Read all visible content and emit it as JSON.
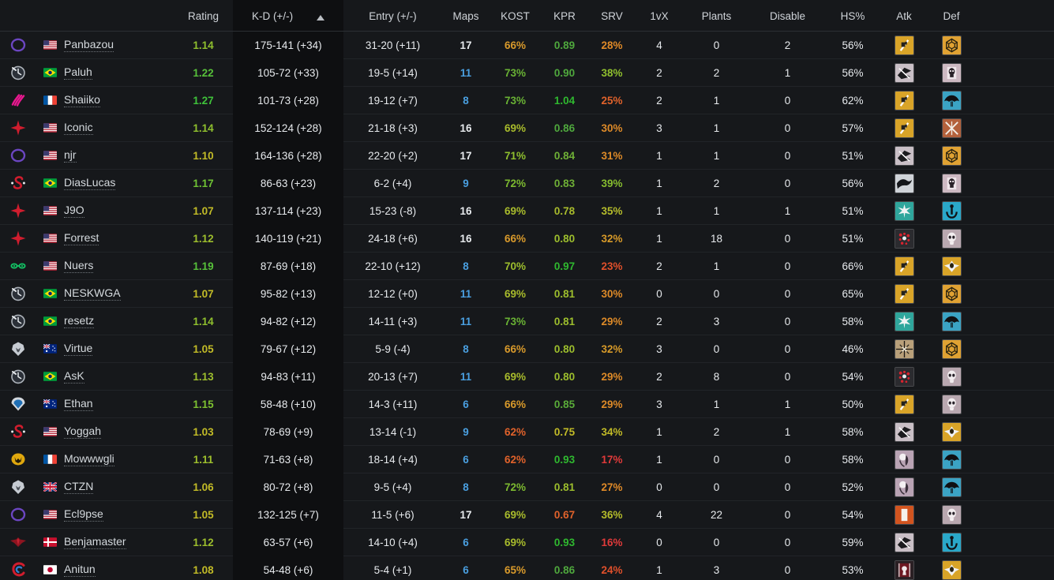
{
  "table": {
    "columns": [
      {
        "key": "logo",
        "label": ""
      },
      {
        "key": "name",
        "label": ""
      },
      {
        "key": "rating",
        "label": "Rating"
      },
      {
        "key": "kd",
        "label": "K-D (+/-)"
      },
      {
        "key": "entry",
        "label": "Entry (+/-)"
      },
      {
        "key": "maps",
        "label": "Maps"
      },
      {
        "key": "kost",
        "label": "KOST"
      },
      {
        "key": "kpr",
        "label": "KPR"
      },
      {
        "key": "srv",
        "label": "SRV"
      },
      {
        "key": "onevx",
        "label": "1vX"
      },
      {
        "key": "plants",
        "label": "Plants"
      },
      {
        "key": "disable",
        "label": "Disable"
      },
      {
        "key": "hs",
        "label": "HS%"
      },
      {
        "key": "atk",
        "label": "Atk"
      },
      {
        "key": "def",
        "label": "Def"
      }
    ],
    "sort": {
      "column": "kd",
      "direction": "ascending",
      "indicator": "sort-ascending-icon"
    },
    "rows": [
      {
        "logo": "purple-ring-logo",
        "flag": "us",
        "name": "Panbazou",
        "rating": "1.14",
        "rating_color": "#8fbf2e",
        "kd": "175-141 (+34)",
        "entry": "31-20 (+11)",
        "maps": "17",
        "maps_color": "#e7eaed",
        "kost": "66%",
        "kost_color": "#d99a2b",
        "kpr": "0.89",
        "kpr_color": "#4fa83d",
        "srv": "28%",
        "srv_color": "#e08a28",
        "onevx": "4",
        "plants": "0",
        "disable": "2",
        "hs": "56%",
        "atk": "op-fist-gold",
        "def": "op-hex-gold"
      },
      {
        "logo": "clock-logo",
        "flag": "br",
        "name": "Paluh",
        "rating": "1.22",
        "rating_color": "#57c03a",
        "kd": "105-72 (+33)",
        "entry": "19-5 (+14)",
        "maps": "11",
        "maps_color": "#4a9fe0",
        "kost": "73%",
        "kost_color": "#69b234",
        "kpr": "0.90",
        "kpr_color": "#4fa83d",
        "srv": "38%",
        "srv_color": "#8fbf2e",
        "onevx": "2",
        "plants": "2",
        "disable": "1",
        "hs": "56%",
        "atk": "op-shard-grey",
        "def": "op-skull-mauve"
      },
      {
        "logo": "pink-waves-logo",
        "flag": "fr",
        "name": "Shaiiko",
        "rating": "1.27",
        "rating_color": "#3fc23a",
        "kd": "101-73 (+28)",
        "entry": "19-12 (+7)",
        "maps": "8",
        "maps_color": "#4a9fe0",
        "kost": "73%",
        "kost_color": "#69b234",
        "kpr": "1.04",
        "kpr_color": "#2fb82f",
        "srv": "25%",
        "srv_color": "#e0622b",
        "onevx": "2",
        "plants": "1",
        "disable": "0",
        "hs": "62%",
        "atk": "op-fist-gold",
        "def": "op-umbrella-teal"
      },
      {
        "logo": "red-star-logo",
        "flag": "us",
        "name": "Iconic",
        "rating": "1.14",
        "rating_color": "#8fbf2e",
        "kd": "152-124 (+28)",
        "entry": "21-18 (+3)",
        "maps": "16",
        "maps_color": "#e7eaed",
        "kost": "69%",
        "kost_color": "#a8bb2c",
        "kpr": "0.86",
        "kpr_color": "#4fa83d",
        "srv": "30%",
        "srv_color": "#dd8a28",
        "onevx": "3",
        "plants": "1",
        "disable": "0",
        "hs": "57%",
        "atk": "op-fist-gold",
        "def": "op-cross-rust"
      },
      {
        "logo": "purple-ring-logo",
        "flag": "us",
        "name": "njr",
        "rating": "1.10",
        "rating_color": "#c2bb27",
        "kd": "164-136 (+28)",
        "entry": "22-20 (+2)",
        "maps": "17",
        "maps_color": "#e7eaed",
        "kost": "71%",
        "kost_color": "#8fbf2e",
        "kpr": "0.84",
        "kpr_color": "#6fb036",
        "srv": "31%",
        "srv_color": "#dd8a28",
        "onevx": "1",
        "plants": "1",
        "disable": "0",
        "hs": "51%",
        "atk": "op-shard-grey",
        "def": "op-hex-gold"
      },
      {
        "logo": "red-s-logo",
        "flag": "br",
        "name": "DiasLucas",
        "rating": "1.17",
        "rating_color": "#6fc234",
        "kd": "86-63 (+23)",
        "entry": "6-2 (+4)",
        "maps": "9",
        "maps_color": "#4a9fe0",
        "kost": "72%",
        "kost_color": "#7dba30",
        "kpr": "0.83",
        "kpr_color": "#6fb036",
        "srv": "39%",
        "srv_color": "#86bd2f",
        "onevx": "1",
        "plants": "2",
        "disable": "0",
        "hs": "56%",
        "atk": "op-bird-dark",
        "def": "op-skull-mauve"
      },
      {
        "logo": "red-star-logo",
        "flag": "us",
        "name": "J9O",
        "rating": "1.07",
        "rating_color": "#c2bb27",
        "kd": "137-114 (+23)",
        "entry": "15-23 (-8)",
        "maps": "16",
        "maps_color": "#e7eaed",
        "kost": "69%",
        "kost_color": "#a8bb2c",
        "kpr": "0.78",
        "kpr_color": "#a8bb2c",
        "srv": "35%",
        "srv_color": "#b5bc2b",
        "onevx": "1",
        "plants": "1",
        "disable": "1",
        "hs": "51%",
        "atk": "op-wings-teal",
        "def": "op-anchor-cyan"
      },
      {
        "logo": "red-star-logo",
        "flag": "us",
        "name": "Forrest",
        "rating": "1.12",
        "rating_color": "#9dbe2d",
        "kd": "140-119 (+21)",
        "entry": "24-18 (+6)",
        "maps": "16",
        "maps_color": "#e7eaed",
        "kost": "66%",
        "kost_color": "#d99a2b",
        "kpr": "0.80",
        "kpr_color": "#9dbe2d",
        "srv": "32%",
        "srv_color": "#d79a29",
        "onevx": "1",
        "plants": "18",
        "disable": "0",
        "hs": "51%",
        "atk": "op-dots-red",
        "def": "op-skull-pale"
      },
      {
        "logo": "green-eyes-logo",
        "flag": "us",
        "name": "Nuers",
        "rating": "1.19",
        "rating_color": "#57c03a",
        "kd": "87-69 (+18)",
        "entry": "22-10 (+12)",
        "maps": "8",
        "maps_color": "#4a9fe0",
        "kost": "70%",
        "kost_color": "#9dbe2d",
        "kpr": "0.97",
        "kpr_color": "#2fb82f",
        "srv": "23%",
        "srv_color": "#e0502b",
        "onevx": "2",
        "plants": "1",
        "disable": "0",
        "hs": "66%",
        "atk": "op-fist-gold",
        "def": "op-wings-gold"
      },
      {
        "logo": "clock-logo",
        "flag": "br",
        "name": "NESKWGA",
        "rating": "1.07",
        "rating_color": "#c2bb27",
        "kd": "95-82 (+13)",
        "entry": "12-12 (+0)",
        "maps": "11",
        "maps_color": "#4a9fe0",
        "kost": "69%",
        "kost_color": "#a8bb2c",
        "kpr": "0.81",
        "kpr_color": "#9dbe2d",
        "srv": "30%",
        "srv_color": "#dd8a28",
        "onevx": "0",
        "plants": "0",
        "disable": "0",
        "hs": "65%",
        "atk": "op-fist-gold",
        "def": "op-hex-gold"
      },
      {
        "logo": "clock-logo",
        "flag": "br",
        "name": "resetz",
        "rating": "1.14",
        "rating_color": "#8fbf2e",
        "kd": "94-82 (+12)",
        "entry": "14-11 (+3)",
        "maps": "11",
        "maps_color": "#4a9fe0",
        "kost": "73%",
        "kost_color": "#69b234",
        "kpr": "0.81",
        "kpr_color": "#9dbe2d",
        "srv": "29%",
        "srv_color": "#dd8a28",
        "onevx": "2",
        "plants": "3",
        "disable": "0",
        "hs": "58%",
        "atk": "op-wings-teal",
        "def": "op-umbrella-teal"
      },
      {
        "logo": "wolf-logo",
        "flag": "au",
        "name": "Virtue",
        "rating": "1.05",
        "rating_color": "#c2bb27",
        "kd": "79-67 (+12)",
        "entry": "5-9 (-4)",
        "maps": "8",
        "maps_color": "#4a9fe0",
        "kost": "66%",
        "kost_color": "#d99a2b",
        "kpr": "0.80",
        "kpr_color": "#9dbe2d",
        "srv": "32%",
        "srv_color": "#d79a29",
        "onevx": "3",
        "plants": "0",
        "disable": "0",
        "hs": "46%",
        "atk": "op-crosshair-tan",
        "def": "op-hex-gold"
      },
      {
        "logo": "clock-logo",
        "flag": "br",
        "name": "AsK",
        "rating": "1.13",
        "rating_color": "#9dbe2d",
        "kd": "94-83 (+11)",
        "entry": "20-13 (+7)",
        "maps": "11",
        "maps_color": "#4a9fe0",
        "kost": "69%",
        "kost_color": "#a8bb2c",
        "kpr": "0.80",
        "kpr_color": "#9dbe2d",
        "srv": "29%",
        "srv_color": "#dd8a28",
        "onevx": "2",
        "plants": "8",
        "disable": "0",
        "hs": "54%",
        "atk": "op-dots-red",
        "def": "op-skull-pale"
      },
      {
        "logo": "blue-helm-logo",
        "flag": "au",
        "name": "Ethan",
        "rating": "1.15",
        "rating_color": "#7dc131",
        "kd": "58-48 (+10)",
        "entry": "14-3 (+11)",
        "maps": "6",
        "maps_color": "#4a9fe0",
        "kost": "66%",
        "kost_color": "#d99a2b",
        "kpr": "0.85",
        "kpr_color": "#5aac39",
        "srv": "29%",
        "srv_color": "#dd8a28",
        "onevx": "3",
        "plants": "1",
        "disable": "1",
        "hs": "50%",
        "atk": "op-fist-gold",
        "def": "op-skull-pale"
      },
      {
        "logo": "red-s-logo",
        "flag": "us",
        "name": "Yoggah",
        "rating": "1.03",
        "rating_color": "#c2bb27",
        "kd": "78-69 (+9)",
        "entry": "13-14 (-1)",
        "maps": "9",
        "maps_color": "#4a9fe0",
        "kost": "62%",
        "kost_color": "#e0622b",
        "kpr": "0.75",
        "kpr_color": "#c2bb27",
        "srv": "34%",
        "srv_color": "#c2bb27",
        "onevx": "1",
        "plants": "2",
        "disable": "1",
        "hs": "58%",
        "atk": "op-shard-grey",
        "def": "op-wings-gold"
      },
      {
        "logo": "gold-wolf-logo",
        "flag": "fr",
        "name": "Mowwwgli",
        "rating": "1.11",
        "rating_color": "#9dbe2d",
        "kd": "71-63 (+8)",
        "entry": "18-14 (+4)",
        "maps": "6",
        "maps_color": "#4a9fe0",
        "kost": "62%",
        "kost_color": "#e0622b",
        "kpr": "0.93",
        "kpr_color": "#2fb82f",
        "srv": "17%",
        "srv_color": "#e03a3a",
        "onevx": "1",
        "plants": "0",
        "disable": "0",
        "hs": "58%",
        "atk": "op-ghost-mauve",
        "def": "op-umbrella-teal"
      },
      {
        "logo": "wolf-logo",
        "flag": "gb",
        "name": "CTZN",
        "rating": "1.06",
        "rating_color": "#c2bb27",
        "kd": "80-72 (+8)",
        "entry": "9-5 (+4)",
        "maps": "8",
        "maps_color": "#4a9fe0",
        "kost": "72%",
        "kost_color": "#7dba30",
        "kpr": "0.81",
        "kpr_color": "#9dbe2d",
        "srv": "27%",
        "srv_color": "#e08a28",
        "onevx": "0",
        "plants": "0",
        "disable": "0",
        "hs": "52%",
        "atk": "op-ghost-mauve",
        "def": "op-umbrella-teal"
      },
      {
        "logo": "purple-ring-logo",
        "flag": "us",
        "name": "Ecl9pse",
        "rating": "1.05",
        "rating_color": "#c2bb27",
        "kd": "132-125 (+7)",
        "entry": "11-5 (+6)",
        "maps": "17",
        "maps_color": "#e7eaed",
        "kost": "69%",
        "kost_color": "#a8bb2c",
        "kpr": "0.67",
        "kpr_color": "#e0622b",
        "srv": "36%",
        "srv_color": "#b5bc2b",
        "onevx": "4",
        "plants": "22",
        "disable": "0",
        "hs": "54%",
        "atk": "op-door-orange",
        "def": "op-skull-pale"
      },
      {
        "logo": "red-wings-logo",
        "flag": "dk",
        "name": "Benjamaster",
        "rating": "1.12",
        "rating_color": "#9dbe2d",
        "kd": "63-57 (+6)",
        "entry": "14-10 (+4)",
        "maps": "6",
        "maps_color": "#4a9fe0",
        "kost": "69%",
        "kost_color": "#a8bb2c",
        "kpr": "0.93",
        "kpr_color": "#2fb82f",
        "srv": "16%",
        "srv_color": "#e03a3a",
        "onevx": "0",
        "plants": "0",
        "disable": "0",
        "hs": "59%",
        "atk": "op-shard-grey",
        "def": "op-anchor-cyan"
      },
      {
        "logo": "red-blue-c-logo",
        "flag": "jp",
        "name": "Anitun",
        "rating": "1.08",
        "rating_color": "#c2bb27",
        "kd": "54-48 (+6)",
        "entry": "5-4 (+1)",
        "maps": "6",
        "maps_color": "#4a9fe0",
        "kost": "65%",
        "kost_color": "#d99a2b",
        "kpr": "0.86",
        "kpr_color": "#4fa83d",
        "srv": "24%",
        "srv_color": "#e0502b",
        "onevx": "1",
        "plants": "3",
        "disable": "0",
        "hs": "53%",
        "atk": "op-keyhole-red",
        "def": "op-wings-gold"
      }
    ]
  }
}
